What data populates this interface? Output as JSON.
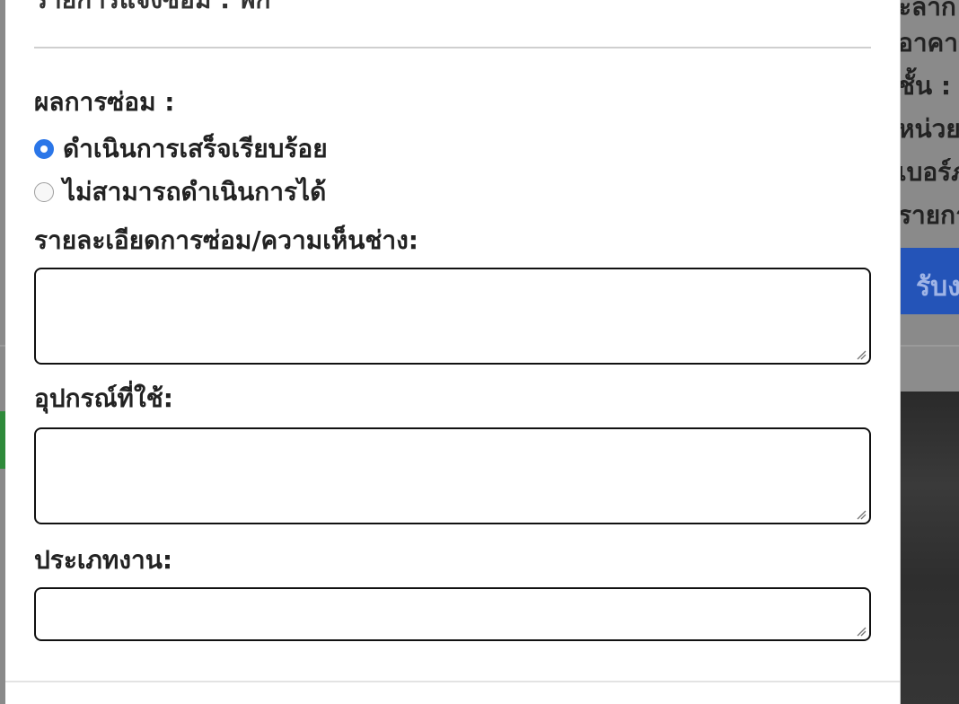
{
  "background": {
    "right_lines": [
      "ะลาก",
      "อาคาร",
      "ชั้น :",
      "หน่วย",
      "เบอร์ภ",
      "รายกา"
    ],
    "right_button_label": "รับง"
  },
  "modal": {
    "title": "รายการแจ้งซ่อม : พิก",
    "repair_result_label": "ผลการซ่อม :",
    "options": [
      {
        "label": "ดำเนินการเสร็จเรียบร้อย",
        "checked": true
      },
      {
        "label": "ไม่สามารถดำเนินการได้",
        "checked": false
      }
    ],
    "details_label": "รายละเอียดการซ่อม/ความเห็นช่าง:",
    "details_value": "",
    "equipment_label": "อุปกรณ์ที่ใช้:",
    "equipment_value": "",
    "job_type_label": "ประเภทงาน:",
    "job_type_value": ""
  },
  "colors": {
    "radio_checked": "#2b76e8",
    "background_button": "#2454b8",
    "overlay": "#7b7b7b"
  }
}
